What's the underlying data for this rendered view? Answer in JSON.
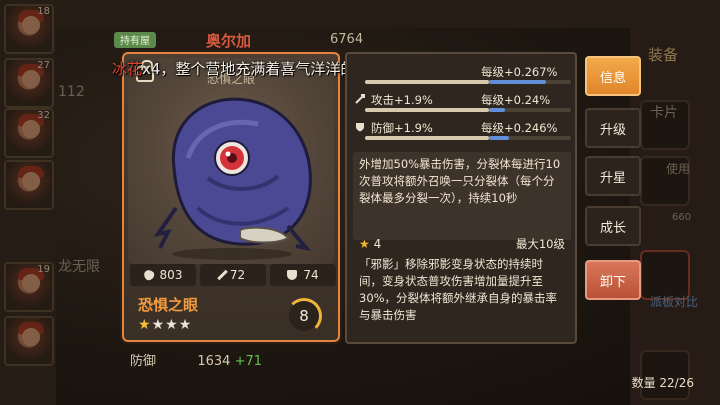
{
  "header": {
    "tag": "持有屋",
    "hero_name_top": "奥尔加",
    "power": "6764"
  },
  "banner": {
    "prefix": "冰花",
    "text": "x4，整个营地充满着喜气洋洋的氛围"
  },
  "card": {
    "art_title": "恐惧之眼",
    "hp": "803",
    "atk": "72",
    "def": "74",
    "name": "恐惧之眼",
    "stars_total": 4,
    "stars_filled": 1,
    "level": "8"
  },
  "attributes": [
    {
      "label": "",
      "percent": "每级+0.267%",
      "fill": 0.6,
      "blue": 0.28
    },
    {
      "label": "攻击+1.9%",
      "percent": "每级+0.24%",
      "fill": 0.6,
      "blue": 0.08
    },
    {
      "label": "防御+1.9%",
      "percent": "每级+0.246%",
      "fill": 0.6,
      "blue": 0.1
    }
  ],
  "description": "外增加50%暴击伤害，分裂体每进行10次普攻将额外召唤一只分裂体（每个分裂体最多分裂一次），持续10秒",
  "skill": {
    "stars": "4",
    "max_label": "最大10级",
    "text": "「邪影」移除邪影变身状态的持续时间，变身状态普攻伤害增加量提升至30%，分裂体将额外继承自身的暴击率与暴击伤害"
  },
  "tabs": {
    "info": "信息",
    "upgrade": "升级",
    "star_up": "升星",
    "growth": "成长",
    "unequip": "卸下"
  },
  "footer": {
    "defense_label": "防御",
    "defense_value": "1634",
    "defense_bonus": "+71",
    "count": "数量 22/26"
  },
  "background": {
    "levels": [
      "18",
      "27",
      "32",
      "19"
    ],
    "left_text_1": "112",
    "left_text_2": "龙无限",
    "right_text_1": "装备",
    "right_text_2": "卡片",
    "right_text_3": "使用",
    "right_text_4": "660",
    "right_text_5": "派板对比"
  },
  "colors": {
    "accent_orange": "#f29a3e",
    "active_tab": "#e0852a",
    "unequip_tab": "#b95136",
    "bar_blue": "#5f8fd6",
    "star_gold": "#f6c23b"
  }
}
